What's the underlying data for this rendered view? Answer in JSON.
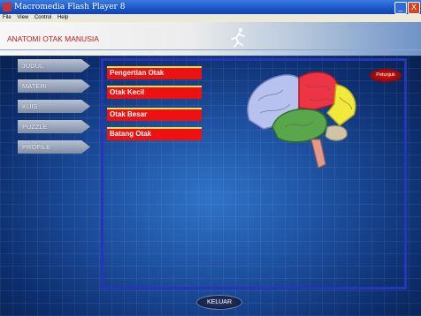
{
  "window": {
    "title": "Macromedia Flash Player 8",
    "menu": [
      "File",
      "View",
      "Control",
      "Help"
    ],
    "minimize": "_",
    "close": "X"
  },
  "header": {
    "title": "ANATOMI OTAK MANUSIA"
  },
  "side_menu": [
    "JUDUL",
    "MATERI",
    "KUIS",
    "PUZZLE",
    "PROFILE"
  ],
  "topics": [
    "Pengertian Otak",
    "Otak Kecil",
    "Otak Besar",
    "Batang Otak"
  ],
  "help_label": "Petunjuk",
  "exit_label": "KELUAR",
  "colors": {
    "accent_red": "#ee1111",
    "frame_blue": "#2536b8",
    "title_red": "#c8161d"
  }
}
